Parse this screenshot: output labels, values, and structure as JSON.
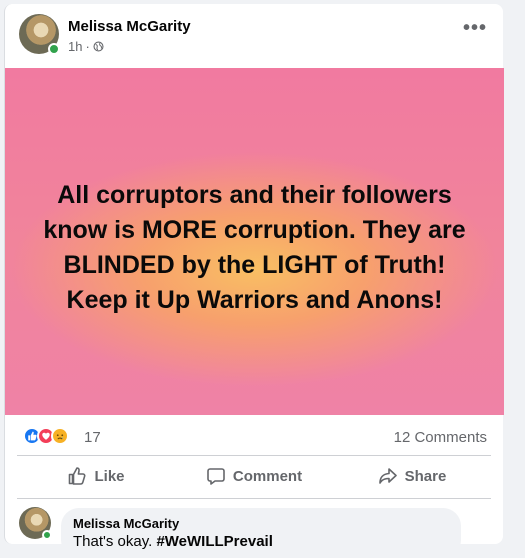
{
  "post": {
    "author": "Melissa McGarity",
    "time": "1h",
    "separator": "·",
    "more_label": "•••",
    "banner_text": "All corruptors and their followers know is MORE corruption. They are BLINDED by the LIGHT of Truth! Keep it Up Warriors and Anons!",
    "reaction_count": "17",
    "comments_count": "12 Comments",
    "colors": {
      "like": "#1877f2",
      "love": "#f33e58",
      "sad": "#f7b125",
      "online": "#31a24c",
      "banner_pink": "#f17aa0",
      "banner_glow": "#f9bf63"
    }
  },
  "actions": {
    "like_label": "Like",
    "comment_label": "Comment",
    "share_label": "Share"
  },
  "comment": {
    "author": "Melissa McGarity",
    "text_plain": "That's okay. ",
    "text_hashtag": "#WeWILLPrevail"
  },
  "icons": {
    "globe": "globe-icon",
    "like": "thumbs-up-icon",
    "comment": "comment-bubble-icon",
    "share": "share-arrow-icon"
  }
}
